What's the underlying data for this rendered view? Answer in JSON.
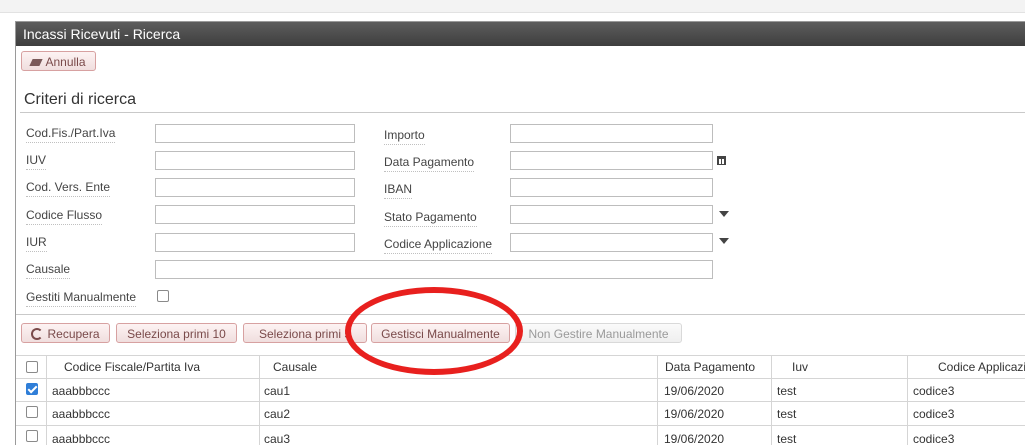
{
  "window": {
    "title": "Incassi Ricevuti - Ricerca"
  },
  "toolbar": {
    "cancel_label": "Annulla"
  },
  "criteria": {
    "title": "Criteri di ricerca",
    "left": [
      {
        "label": "Cod.Fis./Part.Iva",
        "value": ""
      },
      {
        "label": "IUV",
        "value": ""
      },
      {
        "label": "Cod. Vers. Ente",
        "value": ""
      },
      {
        "label": "Codice Flusso",
        "value": ""
      },
      {
        "label": "IUR",
        "value": ""
      }
    ],
    "right": [
      {
        "label": "Importo",
        "value": ""
      },
      {
        "label": "Data Pagamento",
        "value": ""
      },
      {
        "label": "IBAN",
        "value": ""
      },
      {
        "label": "Stato Pagamento",
        "value": ""
      },
      {
        "label": "Codice Applicazione",
        "value": ""
      }
    ],
    "causale": {
      "label": "Causale",
      "value": ""
    },
    "gestiti": {
      "label": "Gestiti Manualmente",
      "checked": false
    }
  },
  "actions": {
    "recupera": "Recupera",
    "sel10": "Seleziona primi 10",
    "sel50": "Seleziona primi 5",
    "gestisci": "Gestisci Manualmente",
    "non_gestire": "Non Gestire Manualmente"
  },
  "table": {
    "columns": [
      "Codice Fiscale/Partita Iva",
      "Causale",
      "Data Pagamento",
      "Iuv",
      "Codice Applicazi"
    ],
    "rows": [
      {
        "checked": true,
        "cf": "aaabbbccc",
        "causale": "cau1",
        "data": "19/06/2020",
        "iuv": "test",
        "codice": "codice3"
      },
      {
        "checked": false,
        "cf": "aaabbbccc",
        "causale": "cau2",
        "data": "19/06/2020",
        "iuv": "test",
        "codice": "codice3"
      },
      {
        "checked": false,
        "cf": "aaabbbccc",
        "causale": "cau3",
        "data": "19/06/2020",
        "iuv": "test",
        "codice": "codice3"
      }
    ]
  },
  "colors": {
    "annotation_circle": "#e8201e",
    "titlebar": "#4a4a4a",
    "checkbox_checked": "#2f7ed8"
  }
}
